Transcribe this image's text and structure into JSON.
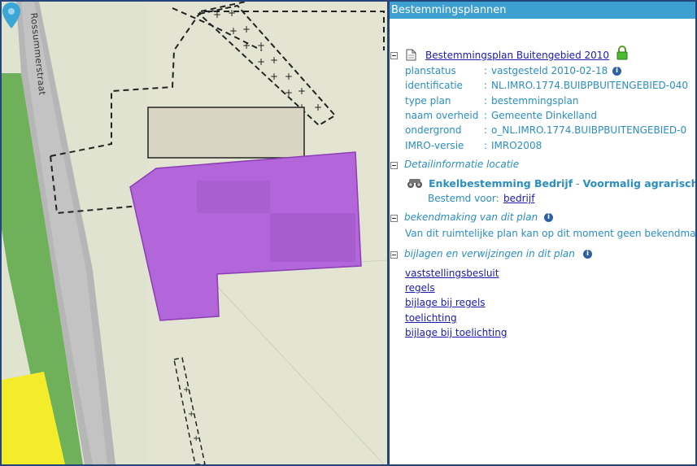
{
  "map": {
    "street_name": "Rossummerstraat",
    "pin_icon": "location-pin-icon",
    "colors": {
      "background": "#dfe3cf",
      "road": "#b8b8b8",
      "green_strip": "#6fb15a",
      "yellow_zone": "#f2ec2a",
      "plan_area": "#b266d9",
      "pin": "#3aa7d6"
    }
  },
  "panel": {
    "title": "Bestemmingsplannen",
    "plan": {
      "name": "Bestemmingsplan Buitengebied 2010",
      "doc_icon": "document-icon",
      "lock_icon": "lock-icon",
      "fields": [
        {
          "label": "planstatus",
          "value": "vastgesteld 2010-02-18",
          "info": true
        },
        {
          "label": "identificatie",
          "value": "NL.IMRO.1774.BUIBPBUITENGEBIED-040"
        },
        {
          "label": "type plan",
          "value": "bestemmingsplan"
        },
        {
          "label": "naam overheid",
          "value": "Gemeente Dinkelland"
        },
        {
          "label": "ondergrond",
          "value": "o_NL.IMRO.1774.BUIBPBUITENGEBIED-0"
        },
        {
          "label": "IMRO-versie",
          "value": "IMRO2008"
        }
      ]
    },
    "detail": {
      "title": "Detailinformatie locatie",
      "bestemming_bold": "Enkelbestemming Bedrijf",
      "bestemming_sep": " - ",
      "bestemming_rest": "Voormalig agrarisch",
      "bestemd_voor_label": "Bestemd voor:",
      "bestemd_voor_link": "bedrijf"
    },
    "bekendmaking": {
      "title": "bekendmaking van dit plan",
      "text": "Van dit ruimtelijke plan kan op dit moment geen bekendma"
    },
    "bijlagen": {
      "title": "bijlagen en verwijzingen in dit plan",
      "links": [
        "vaststellingsbesluit",
        "regels",
        "bijlage bij regels",
        "toelichting",
        "bijlage bij toelichting"
      ]
    },
    "colon": ":"
  }
}
